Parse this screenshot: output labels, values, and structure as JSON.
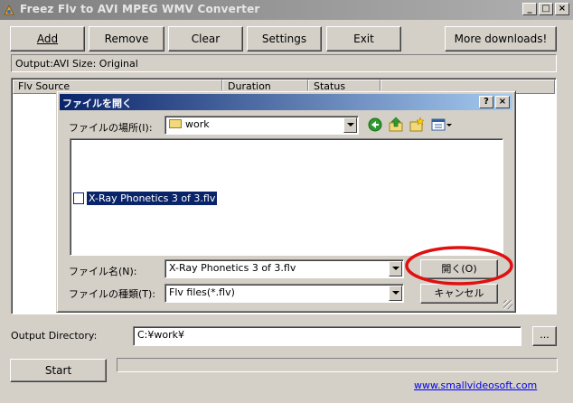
{
  "window": {
    "title": "Freez Flv to AVI MPEG WMV Converter",
    "minimize_label": "_",
    "maximize_label": "□",
    "close_label": "×"
  },
  "toolbar": {
    "add_label": "Add",
    "remove_label": "Remove",
    "clear_label": "Clear",
    "settings_label": "Settings",
    "exit_label": "Exit",
    "more_downloads_label": "More downloads!"
  },
  "output_info": "Output:AVI Size: Original",
  "list": {
    "columns": [
      "Flv Source",
      "Duration",
      "Status"
    ]
  },
  "dialog": {
    "title": "ファイルを開く",
    "help_label": "?",
    "close_label": "×",
    "look_in_label": "ファイルの場所(I):",
    "look_in_value": "work",
    "files": [
      "X-Ray Phonetics 3 of 3.flv"
    ],
    "filename_label": "ファイル名(N):",
    "filename_value": "X-Ray Phonetics 3 of 3.flv",
    "filetype_label": "ファイルの種類(T):",
    "filetype_value": "Flv files(*.flv)",
    "open_label": "開く(O)",
    "cancel_label": "キャンセル"
  },
  "output_directory": {
    "label": "Output Directory:",
    "value": "C:¥work¥",
    "browse_label": "..."
  },
  "start_label": "Start",
  "website_link": "www.smallvideosoft.com",
  "colors": {
    "dialog_title_start": "#0a246a",
    "dialog_title_end": "#a6caf0",
    "annotation_circle": "#e01010",
    "link": "#0000ee"
  }
}
